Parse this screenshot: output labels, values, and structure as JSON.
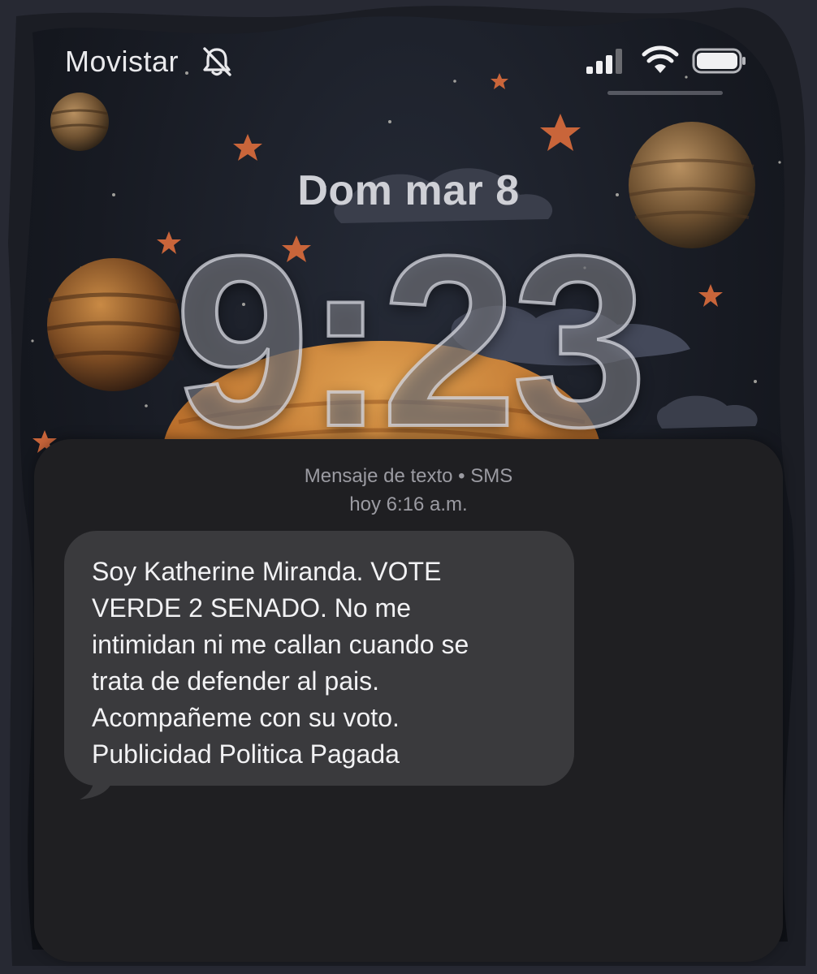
{
  "status_bar": {
    "carrier": "Movistar",
    "mute_icon": "bell-slash-icon",
    "signal_icon": "cellular-signal-icon",
    "wifi_icon": "wifi-icon",
    "battery_icon": "battery-icon"
  },
  "lock_screen": {
    "date": "Dom mar 8",
    "time": "9:23"
  },
  "notification": {
    "source": "Mensaje de texto • SMS",
    "timestamp": "hoy 6:16 a.m.",
    "message": "Soy Katherine Miranda. VOTE\nVERDE 2 SENADO. No me\nintimidan ni me callan cuando se\ntrata de defender al pais.\nAcompañeme con su voto.\nPublicidad Politica Pagada"
  },
  "colors": {
    "card_background": "#1f1f22",
    "bubble_background": "#3a3a3d",
    "secondary_text": "#9b9ba2"
  }
}
